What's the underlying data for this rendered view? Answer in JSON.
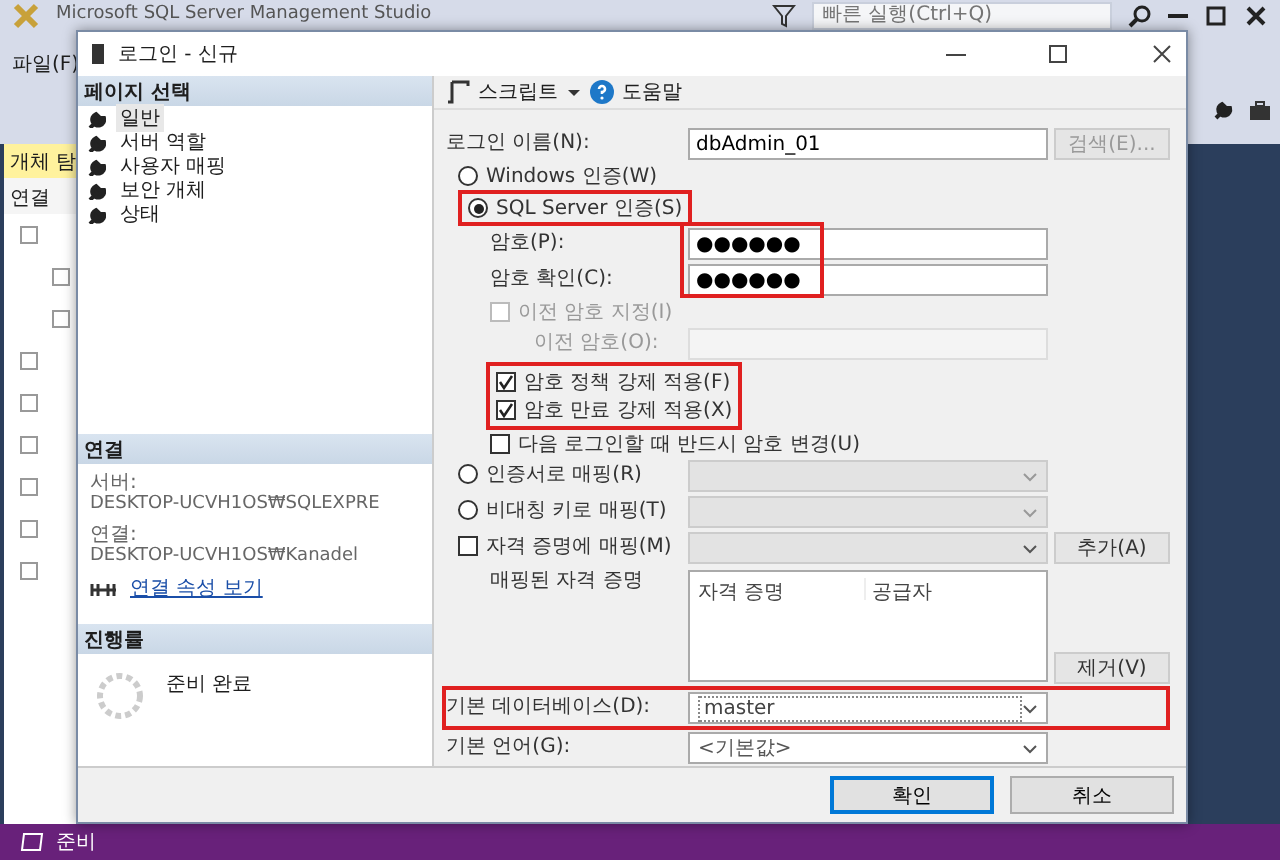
{
  "app": {
    "title": "Microsoft SQL Server Management Studio",
    "quick_launch": {
      "placeholder": "빠른 실행(Ctrl+Q)"
    },
    "menu": [
      "파일(F)"
    ],
    "object_explorer": {
      "tab": "개체 탐",
      "connect": "연결"
    }
  },
  "dialog": {
    "title": "로그인 - 신규",
    "page_select": {
      "heading": "페이지 선택",
      "items": [
        {
          "label": "일반",
          "selected": true
        },
        {
          "label": "서버 역할",
          "selected": false
        },
        {
          "label": "사용자 매핑",
          "selected": false
        },
        {
          "label": "보안 개체",
          "selected": false
        },
        {
          "label": "상태",
          "selected": false
        }
      ]
    },
    "connection": {
      "heading": "연결",
      "server_label": "서버:",
      "server": "DESKTOP-UCVH1OS₩SQLEXPRE",
      "user_label": "연결:",
      "user": "DESKTOP-UCVH1OS₩Kanadel",
      "link": "연결 속성 보기"
    },
    "progress": {
      "heading": "진행률",
      "status": "준비 완료"
    },
    "toolbar": {
      "script": "스크립트",
      "help": "도움말"
    },
    "login_name": {
      "label": "로그인 이름(N):",
      "value": "dbAdmin_01",
      "search": {
        "label": "검색(E)...",
        "disabled": true
      }
    },
    "auth": [
      {
        "label": "Windows 인증(W)",
        "selected": false,
        "highlighted": false
      },
      {
        "label": "SQL Server 인증(S)",
        "selected": true,
        "highlighted": true
      }
    ],
    "passwords": {
      "highlighted": true,
      "fields": [
        {
          "label": "암호(P):",
          "value": "●●●●●●"
        },
        {
          "label": "암호 확인(C):",
          "value": "●●●●●●"
        }
      ]
    },
    "old_password_option": {
      "label": "이전 암호 지정(I)",
      "checked": false,
      "disabled": true
    },
    "old_password": {
      "label": "이전 암호(O):",
      "disabled": true
    },
    "policy": {
      "highlighted": true,
      "options": [
        {
          "label": "암호 정책 강제 적용(F)",
          "checked": true
        },
        {
          "label": "암호 만료 강제 적용(X)",
          "checked": true
        }
      ]
    },
    "must_change": {
      "label": "다음 로그인할 때 반드시 암호 변경(U)",
      "checked": false
    },
    "mappings": [
      {
        "label": "인증서로 매핑(R)",
        "selected": false
      },
      {
        "label": "비대칭 키로 매핑(T)",
        "selected": false
      }
    ],
    "credential": {
      "label": "자격 증명에 매핑(M)",
      "checked": false,
      "add": "추가(A)"
    },
    "mapped_credentials": {
      "label": "매핑된 자격 증명",
      "columns": [
        "자격 증명",
        "공급자"
      ],
      "remove": "제거(V)"
    },
    "default_database": {
      "label": "기본 데이터베이스(D):",
      "value": "master",
      "highlighted": true
    },
    "default_language": {
      "label": "기본 언어(G):",
      "value": "<기본값>"
    },
    "buttons": [
      {
        "label": "확인",
        "default": true
      },
      {
        "label": "취소",
        "default": false
      }
    ]
  },
  "status_bar": "준비"
}
